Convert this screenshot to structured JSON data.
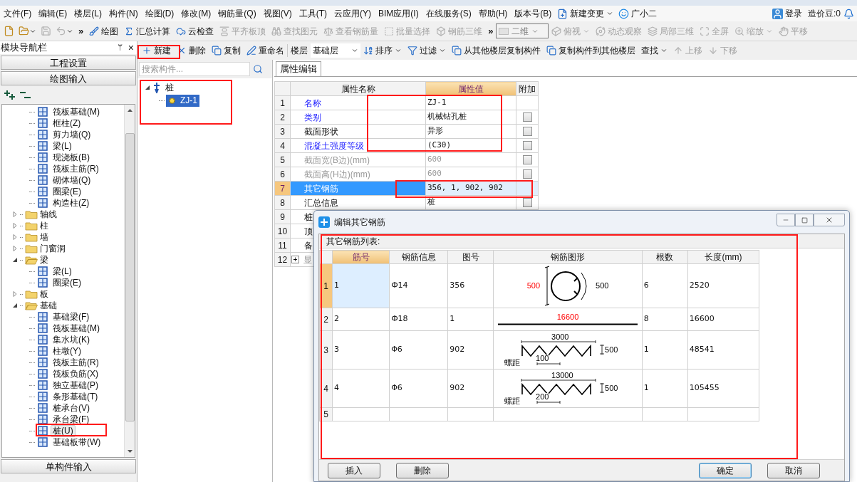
{
  "menu_bar": {
    "items": [
      "文件(F)",
      "编辑(E)",
      "楼层(L)",
      "构件(N)",
      "绘图(D)",
      "修改(M)",
      "钢筋量(Q)",
      "视图(V)",
      "工具(T)",
      "云应用(Y)",
      "BIM应用(I)",
      "在线服务(S)",
      "帮助(H)",
      "版本号(B)"
    ],
    "change_button": "新建变更",
    "assistant": "广小二",
    "login": "登录",
    "beans": "造价豆:0"
  },
  "toolbar": {
    "icon_buttons": [
      {
        "disabled": false,
        "dropdown": false
      },
      {
        "disabled": false,
        "dropdown": true
      },
      {
        "disabled": true,
        "dropdown": false
      },
      {
        "disabled": true,
        "dropdown": true
      }
    ],
    "overflow": "»",
    "buttons": [
      {
        "label": "绘图",
        "disabled": false
      },
      {
        "label": "汇总计算",
        "disabled": false
      },
      {
        "label": "云检查",
        "disabled": false
      },
      {
        "label": "平齐板顶",
        "disabled": true
      },
      {
        "label": "查找图元",
        "disabled": true
      },
      {
        "label": "查看钢筋量",
        "disabled": true
      },
      {
        "label": "批量选择",
        "disabled": true
      },
      {
        "label": "钢筋三维",
        "disabled": true
      }
    ],
    "overflow_2": "»",
    "view_select": "二维",
    "view_buttons": [
      {
        "label": "俯视",
        "disabled": true,
        "dropdown": true
      },
      {
        "label": "动态观察",
        "disabled": true,
        "dropdown": false
      },
      {
        "label": "局部三维",
        "disabled": true,
        "dropdown": false
      },
      {
        "label": "全屏",
        "disabled": true,
        "dropdown": false
      },
      {
        "label": "缩放",
        "disabled": true,
        "dropdown": true
      },
      {
        "label": "平移",
        "disabled": true,
        "dropdown": false
      }
    ]
  },
  "nav": {
    "title": "模块导航栏",
    "pin": "ᛘ",
    "close": "×",
    "sections_top": [
      "工程设置",
      "绘图输入"
    ],
    "tree_continued": [
      {
        "label": "筏板基础(M)",
        "selected": false
      },
      {
        "label": "框柱(Z)",
        "selected": false
      },
      {
        "label": "剪力墙(Q)",
        "selected": false
      },
      {
        "label": "梁(L)",
        "selected": false
      },
      {
        "label": "现浇板(B)",
        "selected": false
      },
      {
        "label": "筏板主筋(R)",
        "selected": false
      },
      {
        "label": "砌体墙(Q)",
        "selected": false
      },
      {
        "label": "圈梁(E)",
        "selected": false
      },
      {
        "label": "构造柱(Z)",
        "selected": false
      }
    ],
    "tree": [
      {
        "label": "轴线",
        "expanded": false
      },
      {
        "label": "柱",
        "expanded": false
      },
      {
        "label": "墙",
        "expanded": false
      },
      {
        "label": "门窗洞",
        "expanded": false
      },
      {
        "label": "梁",
        "expanded": true,
        "children": [
          {
            "label": "梁(L)",
            "selected": false
          },
          {
            "label": "圈梁(E)",
            "selected": false
          }
        ]
      },
      {
        "label": "板",
        "expanded": false
      },
      {
        "label": "基础",
        "expanded": true,
        "children": [
          {
            "label": "基础梁(F)",
            "selected": false
          },
          {
            "label": "筏板基础(M)",
            "selected": false
          },
          {
            "label": "集水坑(K)",
            "selected": false
          },
          {
            "label": "柱墩(Y)",
            "selected": false
          },
          {
            "label": "筏板主筋(R)",
            "selected": false
          },
          {
            "label": "筏板负筋(X)",
            "selected": false
          },
          {
            "label": "独立基础(P)",
            "selected": false
          },
          {
            "label": "条形基础(T)",
            "selected": false
          },
          {
            "label": "桩承台(V)",
            "selected": false
          },
          {
            "label": "承台梁(F)",
            "selected": false
          },
          {
            "label": "桩(U)",
            "selected": true
          },
          {
            "label": "基础板带(W)",
            "selected": false
          }
        ]
      }
    ],
    "sections_bottom": [
      "单构件输入"
    ]
  },
  "component_toolbar": {
    "buttons": [
      {
        "label": "新建",
        "disabled": false,
        "dropdown": false
      },
      {
        "label": "删除",
        "disabled": false,
        "dropdown": false
      },
      {
        "label": "复制",
        "disabled": false,
        "dropdown": false
      },
      {
        "label": "重命名",
        "disabled": false,
        "dropdown": false
      }
    ],
    "floor_label": "楼层",
    "floor": "基础层",
    "buttons_2": [
      {
        "label": "排序",
        "disabled": false,
        "dropdown": true
      },
      {
        "label": "过滤",
        "disabled": false,
        "dropdown": true
      },
      {
        "label": "从其他楼层复制构件",
        "disabled": false,
        "dropdown": false
      },
      {
        "label": "复制构件到其他楼层",
        "disabled": false,
        "dropdown": false
      },
      {
        "label": "查找",
        "disabled": false,
        "dropdown": true
      },
      {
        "label": "上移",
        "disabled": true,
        "dropdown": false
      },
      {
        "label": "下移",
        "disabled": true,
        "dropdown": false
      }
    ]
  },
  "component_list": {
    "search_placeholder": "搜索构件...",
    "tree": [
      {
        "label": "桩",
        "expanded": true,
        "children": [
          {
            "label": "ZJ-1",
            "selected": true
          }
        ]
      }
    ]
  },
  "property_panel": {
    "tab": "属性编辑",
    "columns": [
      "属性名称",
      "属性值",
      "附加"
    ],
    "rows": [
      {
        "index": "1",
        "name": "名称",
        "value": "ZJ-1",
        "linked": true,
        "disabled": false,
        "selected": false
      },
      {
        "index": "2",
        "name": "类别",
        "value": "机械钻孔桩",
        "linked": true,
        "disabled": false,
        "selected": false,
        "checkbox": {
          "checked": false
        }
      },
      {
        "index": "3",
        "name": "截面形状",
        "value": "异形",
        "linked": false,
        "disabled": false,
        "selected": false,
        "checkbox": {
          "checked": false
        }
      },
      {
        "index": "4",
        "name": "混凝土强度等级",
        "value": "(C30)",
        "linked": true,
        "disabled": false,
        "selected": false,
        "checkbox": {
          "checked": false
        }
      },
      {
        "index": "5",
        "name": "截面宽(B边)(mm)",
        "value": "600",
        "linked": false,
        "disabled": true,
        "selected": false,
        "checkbox": {
          "checked": false
        }
      },
      {
        "index": "6",
        "name": "截面高(H边)(mm)",
        "value": "600",
        "linked": false,
        "disabled": true,
        "selected": false,
        "checkbox": {
          "checked": false
        }
      },
      {
        "index": "7",
        "name": "其它钢筋",
        "value": "356, 1, 902, 902",
        "linked": false,
        "disabled": false,
        "selected": true
      },
      {
        "index": "8",
        "name": "汇总信息",
        "value": "桩",
        "linked": false,
        "disabled": false,
        "selected": false,
        "checkbox": {
          "checked": false
        }
      },
      {
        "index": "9",
        "name": "桩",
        "linked": false,
        "disabled": false,
        "selected": false
      },
      {
        "index": "10",
        "name": "顶",
        "linked": false,
        "disabled": false,
        "selected": false
      },
      {
        "index": "11",
        "name": "备",
        "linked": false,
        "disabled": false,
        "selected": false
      },
      {
        "index": "12",
        "name": "显",
        "expander": "+",
        "linked": false,
        "disabled": true,
        "selected": false
      }
    ]
  },
  "dialog": {
    "title": "编辑其它钢筋",
    "list_label": "其它钢筋列表:",
    "columns": [
      {
        "label": "筋号",
        "selected": true
      },
      {
        "label": "钢筋信息",
        "selected": false
      },
      {
        "label": "图号",
        "selected": false
      },
      {
        "label": "钢筋图形",
        "selected": false
      },
      {
        "label": "根数",
        "selected": false
      },
      {
        "label": "长度(mm)",
        "selected": false
      }
    ],
    "rows": [
      {
        "index": "1",
        "selected": true,
        "bar_no": "1",
        "info": "Ф14",
        "shape_no": "356",
        "shape": {
          "kind": "ring",
          "labels": [
            {
              "text": "500",
              "highlighted": true
            },
            {
              "text": "500",
              "highlighted": false
            }
          ]
        },
        "count": "6",
        "length": "2520"
      },
      {
        "index": "2",
        "selected": false,
        "bar_no": "2",
        "info": "Ф18",
        "shape_no": "1",
        "shape": {
          "kind": "line",
          "labels": [
            {
              "text": "16600",
              "highlighted": true
            }
          ]
        },
        "count": "8",
        "length": "16600"
      },
      {
        "index": "3",
        "selected": false,
        "bar_no": "3",
        "info": "Φ6",
        "shape_no": "902",
        "shape": {
          "kind": "spiral",
          "labels": [
            {
              "text": "3000",
              "highlighted": false
            },
            {
              "text": "500",
              "highlighted": false
            },
            {
              "text": "螺距",
              "highlighted": false
            },
            {
              "text": "100",
              "highlighted": false
            }
          ]
        },
        "count": "1",
        "length": "48541"
      },
      {
        "index": "4",
        "selected": false,
        "bar_no": "4",
        "info": "Φ6",
        "shape_no": "902",
        "shape": {
          "kind": "spiral",
          "labels": [
            {
              "text": "13000",
              "highlighted": false
            },
            {
              "text": "500",
              "highlighted": false
            },
            {
              "text": "螺距",
              "highlighted": false
            },
            {
              "text": "200",
              "highlighted": false
            }
          ]
        },
        "count": "1",
        "length": "105455"
      },
      {
        "index": "5",
        "selected": false
      }
    ],
    "buttons": [
      {
        "label": "插入",
        "default": false
      },
      {
        "label": "删除",
        "default": false
      },
      {
        "label": "确定",
        "default": true
      },
      {
        "label": "取消",
        "default": false
      }
    ]
  }
}
